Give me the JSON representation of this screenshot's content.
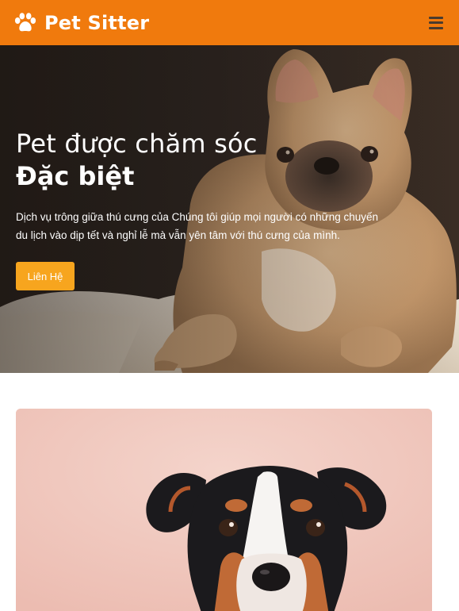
{
  "navbar": {
    "brand": "Pet Sitter",
    "brand_icon": "paw-icon",
    "menu_icon": "hamburger-menu-icon",
    "background": "#f07a0d"
  },
  "hero": {
    "title_line1": "Pet được chăm sóc",
    "title_line2": "Đặc biệt",
    "description": "Dịch vụ trông giữa thú cưng của Chúng tôi giúp mọi người có những chuyến du lịch vào dịp tết và nghỉ lễ mà vẫn yên tâm với thú cưng của mình.",
    "cta_label": "Liên Hệ",
    "cta_color": "#f7a51e"
  }
}
